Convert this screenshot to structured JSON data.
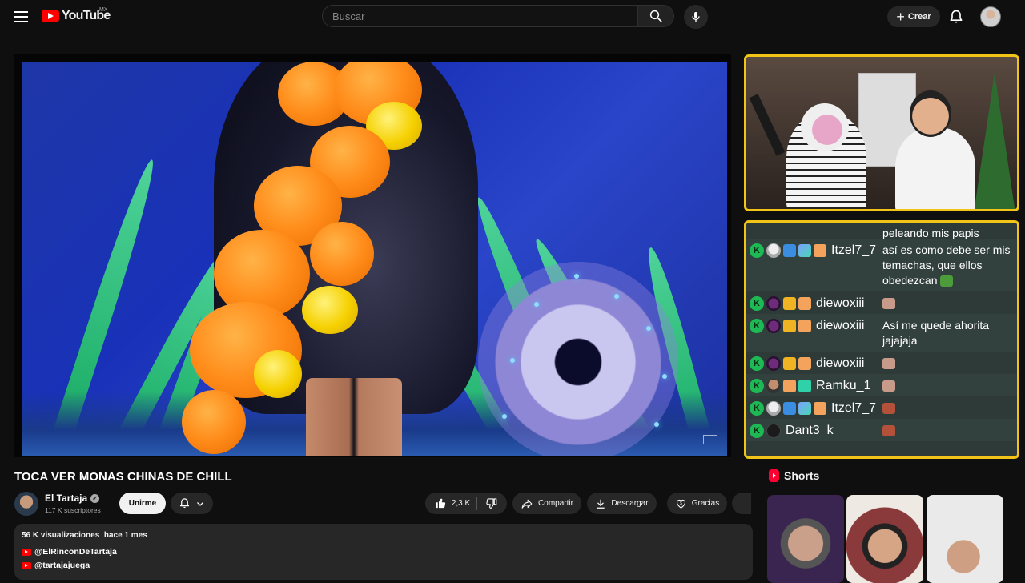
{
  "topbar": {
    "logo_text": "YouTube",
    "country": "MX",
    "search_placeholder": "Buscar",
    "create_label": "Crear"
  },
  "video": {
    "title": "TOCA VER MONAS CHINAS DE CHILL"
  },
  "channel": {
    "name": "El Tartaja",
    "subscribers": "117 K suscriptores",
    "join_label": "Unirme"
  },
  "actions": {
    "likes": "2,3 K",
    "share_label": "Compartir",
    "download_label": "Descargar",
    "thanks_label": "Gracias"
  },
  "description": {
    "views": "56 K visualizaciones",
    "date": "hace 1 mes",
    "link1": "@ElRinconDeTartaja",
    "link2": "@tartajajuega"
  },
  "chat": {
    "messages": [
      {
        "user": "",
        "text": "peleando mis papis"
      },
      {
        "user": "Itzel7_7",
        "text": "así es como debe ser mis temachas, que ellos obedezcan"
      },
      {
        "user": "diewoxiii",
        "text": ""
      },
      {
        "user": "diewoxiii",
        "text": "Así me quede ahorita jajajaja"
      },
      {
        "user": "diewoxiii",
        "text": ""
      },
      {
        "user": "Ramku_1",
        "text": ""
      },
      {
        "user": "Itzel7_7",
        "text": ""
      },
      {
        "user": "Dant3_k",
        "text": ""
      }
    ]
  },
  "shorts": {
    "title": "Shorts"
  },
  "colors": {
    "accent_border": "#f2c418",
    "youtube_red": "#ff0000",
    "chat_bg": "#2d3a37"
  }
}
